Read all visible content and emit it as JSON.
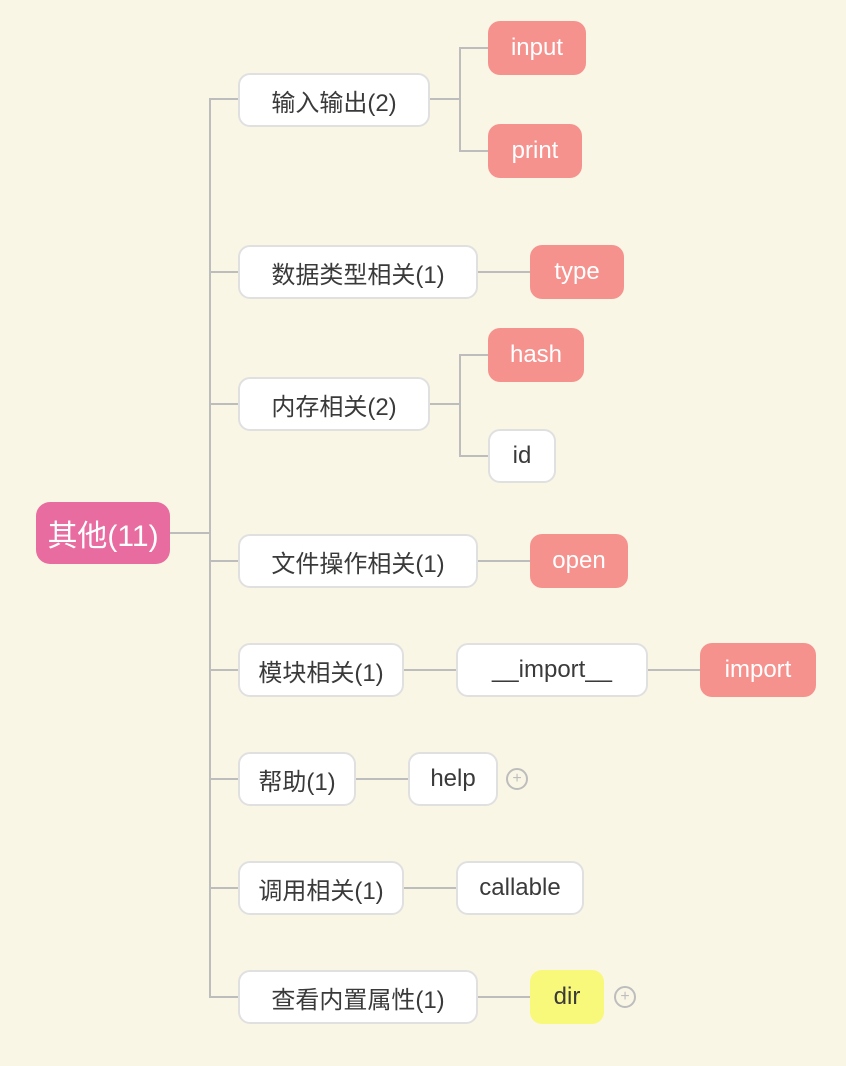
{
  "root": {
    "label": "其他(11)"
  },
  "branches": {
    "io": {
      "label": "输入输出(2)",
      "children": {
        "input": "input",
        "print": "print"
      }
    },
    "type": {
      "label": "数据类型相关(1)",
      "children": {
        "type": "type"
      }
    },
    "memory": {
      "label": "内存相关(2)",
      "children": {
        "hash": "hash",
        "id": "id"
      }
    },
    "file": {
      "label": "文件操作相关(1)",
      "children": {
        "open": "open"
      }
    },
    "module": {
      "label": "模块相关(1)",
      "children": {
        "import_dunder": "__import__",
        "import": "import"
      }
    },
    "help": {
      "label": "帮助(1)",
      "children": {
        "help": "help"
      }
    },
    "call": {
      "label": "调用相关(1)",
      "children": {
        "callable": "callable"
      }
    },
    "attr": {
      "label": "查看内置属性(1)",
      "children": {
        "dir": "dir"
      }
    }
  },
  "icons": {
    "expand": "+"
  }
}
